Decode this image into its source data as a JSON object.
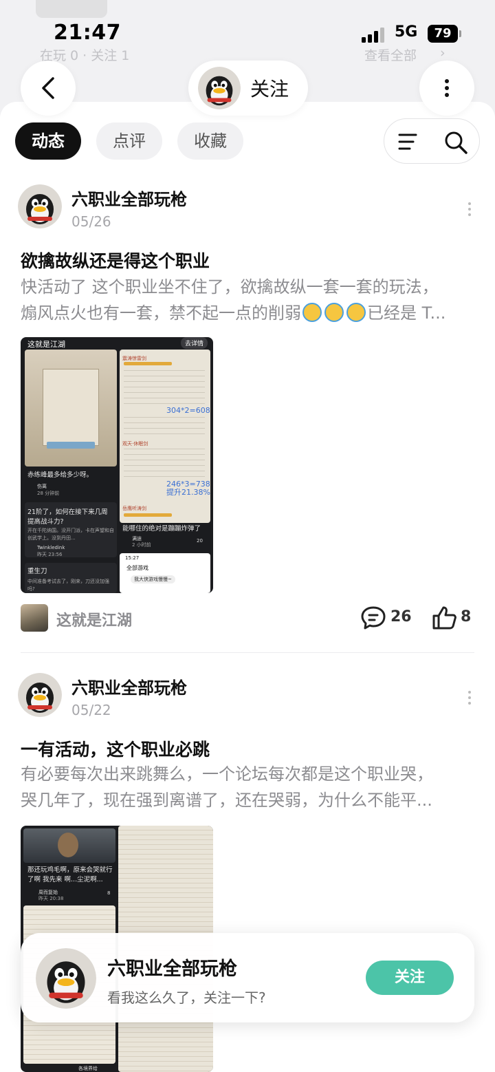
{
  "status_bar": {
    "time": "21:47",
    "network": "5G",
    "battery": "79"
  },
  "background_profile": {
    "stats": "在玩 0 · 关注 1",
    "view_all": "查看全部"
  },
  "header": {
    "follow_label": "关注"
  },
  "tabs": [
    {
      "label": "动态",
      "active": true
    },
    {
      "label": "点评",
      "active": false
    },
    {
      "label": "收藏",
      "active": false
    }
  ],
  "posts": [
    {
      "author": "六职业全部玩枪",
      "date": "05/26",
      "title": "欲擒故纵还是得这个职业",
      "body_line1": "快活动了  这个职业坐不住了，欲擒故纵一套一套的玩法，",
      "body_line2_a": "煽风点火也有一套，禁不起一点的削弱",
      "body_line2_b": "已经是 T...",
      "emoji_count": 3,
      "image": {
        "app_title": "这就是江湖",
        "detail_btn": "去详情",
        "tile1_text": "赤练峰最多给多少呀。",
        "tile1_user": "伤离",
        "tile1_time": "28 分钟前",
        "tile2_text": "21阶了，如何在接下来几周提高战斗力?",
        "tile2_sub": "开在千陀纳国。没开门派，卡在声望和自创武学上。没到丹田...",
        "tile2_user": "Twinkledink",
        "tile2_time": "昨天 23:56",
        "tile3_text": "重生刀",
        "tile3_sub": "中间准备考试去了，刚来，刀还没加强吗?",
        "calc1": "304*2=608",
        "calc2": "246*3=738",
        "calc3": "提升21.38%",
        "sec1": "震涛惊雷剑",
        "sec2": "观天·休眠剑",
        "sec3": "岳鹰听涛剑",
        "tile4_text": "能哪住的绝对是蹦蹦炸弹了",
        "tile4_user": "满途",
        "tile4_time": "2 小时前",
        "tile4_count": "20",
        "mini_time": "15:27",
        "mini_title": "全部游戏",
        "mini_tag": "我大侠游戏慢慢~"
      },
      "game": "这就是江湖",
      "comments": "26",
      "likes": "8"
    },
    {
      "author": "六职业全部玩枪",
      "date": "05/22",
      "title": "一有活动，这个职业必跳",
      "body_line1": "有必要每次出来跳舞么，一个论坛每次都是这个职业哭，",
      "body_line2": "哭几年了，现在强到离谱了，还在哭弱，为什么不能平...",
      "image": {
        "tile1_text": "那还玩鸡毛啊，原来会哭就行了啊 我先来 啊...尘泥啊...",
        "tile1_user": "周而复始",
        "tile1_time": "昨天 20:38",
        "tile1_count": "8",
        "tile_bottom_label": "各境界给"
      }
    }
  ],
  "follow_popup": {
    "name": "六职业全部玩枪",
    "subtitle": "看我这么久了，关注一下?",
    "button": "关注"
  },
  "colors": {
    "accent": "#4cc4a8",
    "tab_active": "#111111",
    "muted_text": "#8c8c90"
  }
}
